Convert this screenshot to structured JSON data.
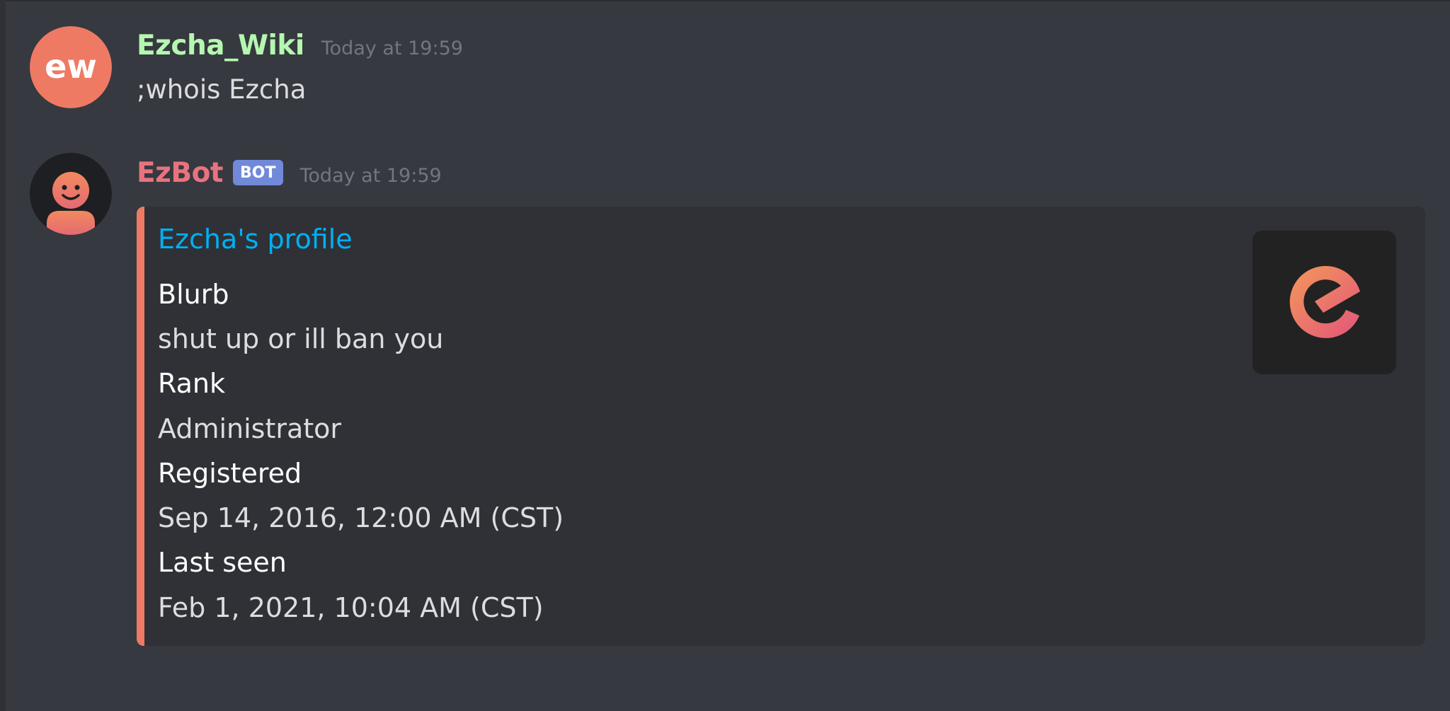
{
  "messages": [
    {
      "username": "Ezcha_Wiki",
      "username_color": "#b5f7b0",
      "timestamp": "Today at 19:59",
      "content": ";whois Ezcha",
      "avatar_icon": "ezcha-wiki-logo-icon",
      "avatar_text": "ew"
    },
    {
      "username": "EzBot",
      "username_color": "#e8737f",
      "bot_tag": "BOT",
      "timestamp": "Today at 19:59",
      "avatar_icon": "ezbot-smiley-icon",
      "embed": {
        "accent_color": "#ee7a65",
        "title": "Ezcha's profile",
        "title_color": "#00b0f4",
        "thumbnail_icon": "ezcha-logo-icon",
        "fields": [
          {
            "name": "Blurb",
            "value": "shut up or ill ban you"
          },
          {
            "name": "Rank",
            "value": "Administrator"
          },
          {
            "name": "Registered",
            "value": "Sep 14, 2016, 12:00 AM (CST)"
          },
          {
            "name": "Last seen",
            "value": "Feb 1, 2021, 10:04 AM (CST)"
          }
        ]
      }
    }
  ],
  "colors": {
    "background": "#36393f",
    "embed_background": "#2f3136",
    "timestamp": "#72767d",
    "text": "#dcddde",
    "bot_tag": "#7289da"
  }
}
